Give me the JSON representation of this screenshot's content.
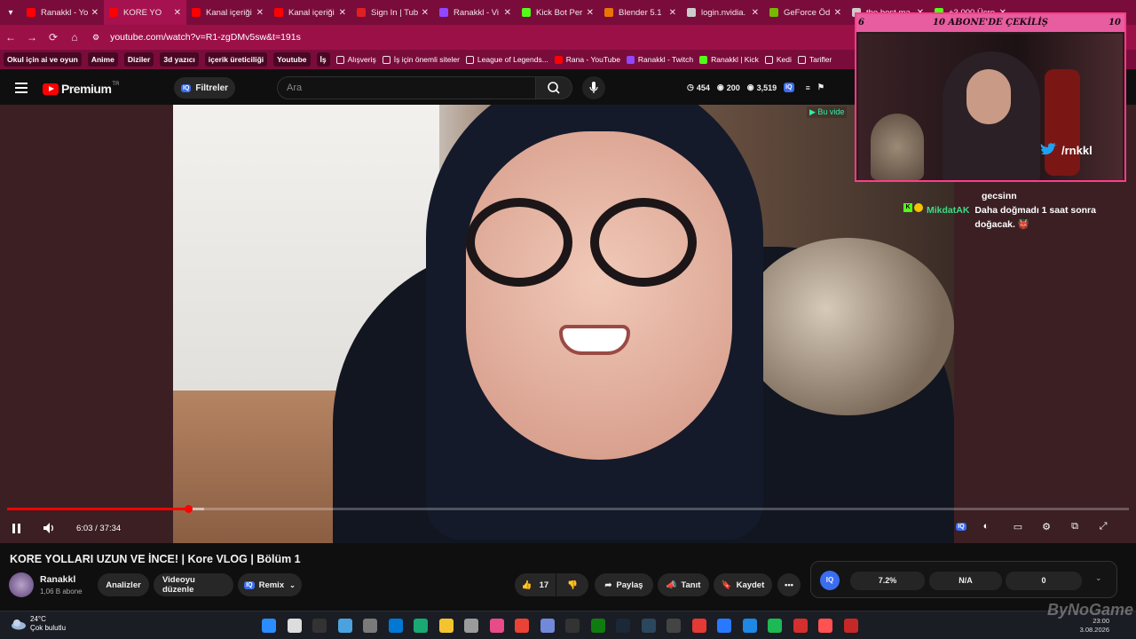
{
  "browser": {
    "tabs": [
      {
        "label": "Ranakkl - Yo",
        "color": "#ff0000"
      },
      {
        "label": "KORE YO",
        "color": "#ff0000",
        "active": true
      },
      {
        "label": "Kanal içeriği",
        "color": "#ff0000"
      },
      {
        "label": "Kanal içeriği",
        "color": "#ff0000"
      },
      {
        "label": "Sign In | Tub",
        "color": "#e02020"
      },
      {
        "label": "Ranakkl - Vi",
        "color": "#9146ff"
      },
      {
        "label": "Kick Bot Per",
        "color": "#53fc18"
      },
      {
        "label": "Blender 5.1",
        "color": "#ea7600"
      },
      {
        "label": "login.nvidia.",
        "color": "#cccccc"
      },
      {
        "label": "GeForce Öd",
        "color": "#76b900"
      },
      {
        "label": "the best ma",
        "color": "#cccccc"
      },
      {
        "label": "+3.000 Ücre",
        "color": "#53fc18"
      }
    ],
    "url": "youtube.com/watch?v=R1-zgDMv5sw&t=191s",
    "bookmarks": [
      {
        "label": "Okul için ai ve oyun",
        "chip": true
      },
      {
        "label": "Anime",
        "chip": true
      },
      {
        "label": "Diziler",
        "chip": true
      },
      {
        "label": "3d yazıcı",
        "chip": true
      },
      {
        "label": "içerik üreticiliği",
        "chip": true
      },
      {
        "label": "Youtube",
        "chip": true
      },
      {
        "label": "İş",
        "chip": true
      },
      {
        "label": "Alışveriş",
        "icon": "folder"
      },
      {
        "label": "İş için önemli siteler",
        "icon": "folder"
      },
      {
        "label": "League of Legends...",
        "icon": "folder"
      },
      {
        "label": "Rana - YouTube",
        "icon": "youtube"
      },
      {
        "label": "Ranakkl - Twitch",
        "icon": "twitch"
      },
      {
        "label": "Ranakkl | Kick",
        "icon": "kick"
      },
      {
        "label": "Kedi",
        "icon": "folder"
      },
      {
        "label": "Tarifler",
        "icon": "folder"
      }
    ]
  },
  "youtube": {
    "logo_text": "Premium",
    "logo_country": "TR",
    "filter_label": "Filtreler",
    "search_placeholder": "Ara",
    "stats": [
      "454",
      "200",
      "3,519"
    ],
    "bu_video": "▶ Bu vide"
  },
  "player": {
    "current_time": "6:03",
    "duration": "37:34",
    "time_display": "6:03 / 37:34",
    "progress_fraction": 0.161,
    "buffered_fraction": 0.176
  },
  "overlay": {
    "banner": "10 ABONE'DE ÇEKİLİŞ",
    "left_num": "6",
    "right_num": "10",
    "handle": "/rnkkl"
  },
  "chat": {
    "lines_top": [
      "gecsinn"
    ],
    "username": "MikdatAK",
    "message": "Daha doğmadı 1 saat sonra doğacak.",
    "emote": "👹"
  },
  "video_info": {
    "title": "KORE YOLLARI UZUN VE İNCE! | Kore VLOG | Bölüm 1",
    "channel": "Ranakkl",
    "subscribers": "1,06 B abone",
    "analytics_label": "Analizler",
    "edit_label": "Videoyu düzenle",
    "remix_label": "Remix",
    "likes": "17",
    "share_label": "Paylaş",
    "promote_label": "Tanıt",
    "save_label": "Kaydet",
    "iq_stats": [
      "7.2%",
      "N/A",
      "0"
    ]
  },
  "taskbar": {
    "temperature": "24°C",
    "weather": "Çok bulutlu",
    "time": "23:00",
    "date": "3.08.2026",
    "watermark": "ByNoGame"
  }
}
